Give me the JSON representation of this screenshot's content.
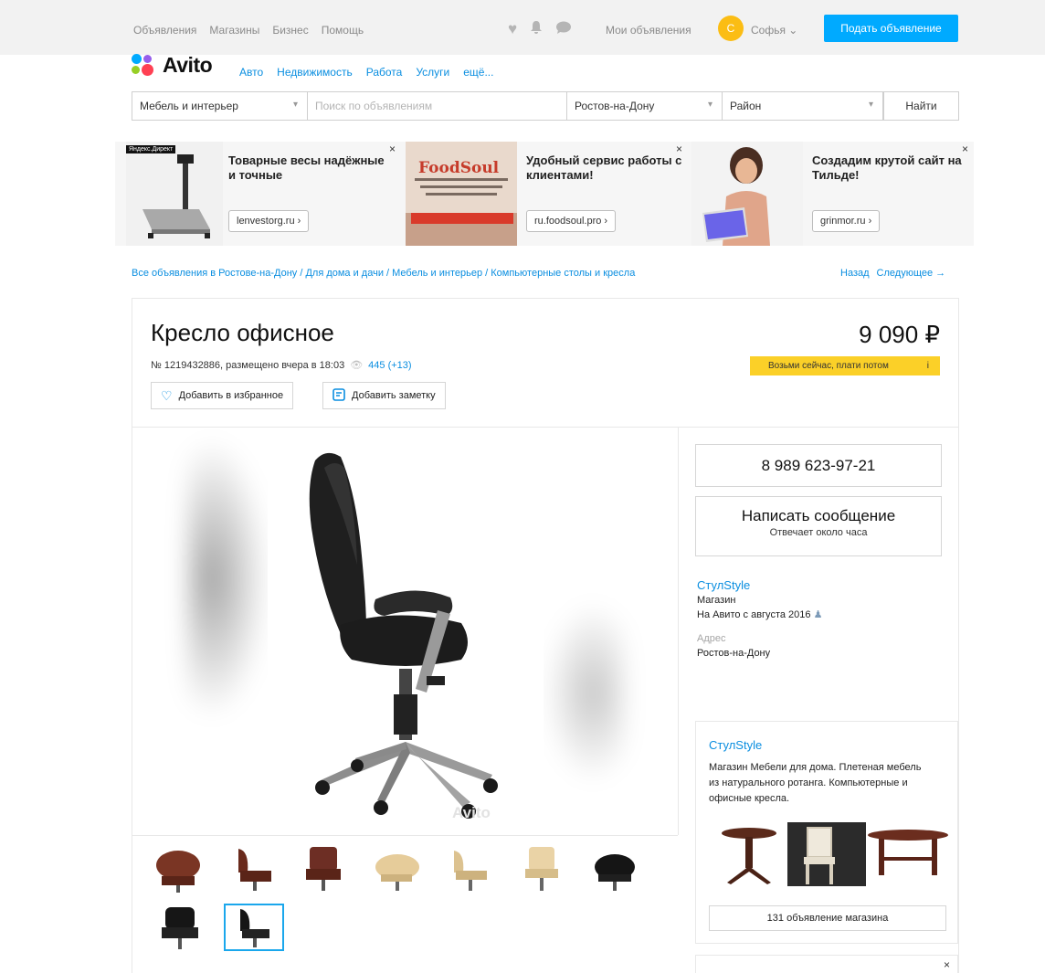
{
  "topbar": {
    "nav": [
      "Объявления",
      "Магазины",
      "Бизнес",
      "Помощь"
    ],
    "my_ads": "Мои объявления",
    "avatar_letter": "С",
    "user_name": "Софья ⌄",
    "post_button": "Подать объявление"
  },
  "logo": {
    "text": "Avito"
  },
  "categories": [
    "Авто",
    "Недвижимость",
    "Работа",
    "Услуги",
    "ещё..."
  ],
  "search": {
    "category": "Мебель и интерьер",
    "placeholder": "Поиск по объявлениям",
    "city": "Ростов-на-Дону",
    "district": "Район",
    "find_button": "Найти"
  },
  "ads": [
    {
      "title": "Товарные весы надёжные и точные",
      "link": "lenvestorg.ru ›",
      "badge": "Яндекс.Директ"
    },
    {
      "title": "Удобный сервис работы с клиентами!",
      "link": "ru.foodsoul.pro ›"
    },
    {
      "title": "Создадим крутой сайт на Тильде!",
      "link": "grinmor.ru ›"
    }
  ],
  "breadcrumb": "Все объявления в Ростове-на-Дону / Для дома и дачи / Мебель и интерьер / Компьютерные столы и кресла",
  "pager": {
    "back": "Назад",
    "next": "Следующее →"
  },
  "listing": {
    "title": "Кресло офисное",
    "price": "9 090 ₽",
    "meta": "№ 1219432886, размещено вчера в 18:03",
    "views": "445 (+13)",
    "bnpl": "Возьми сейчас, плати потом",
    "favorite_button": "Добавить в избранное",
    "note_button": "Добавить заметку",
    "watermark": "Avito"
  },
  "contact": {
    "phone": "8 989 623-97-21",
    "message_title": "Написать сообщение",
    "message_sub": "Отвечает около часа"
  },
  "seller": {
    "name": "СтулStyle",
    "type": "Магазин",
    "since": "На Авито с августа 2016",
    "address_label": "Адрес",
    "address": "Ростов-на-Дону"
  },
  "shop": {
    "name": "СтулStyle",
    "description": "Магазин Мебели для дома. Плетеная мебель из натурального ротанга. Компьютерные и офисные кресла.",
    "button": "131 объявление магазина"
  },
  "colors": {
    "accent": "#00aaff",
    "link": "#0a8ee0",
    "bnpl": "#fbd028",
    "avatar": "#fbbd14"
  }
}
